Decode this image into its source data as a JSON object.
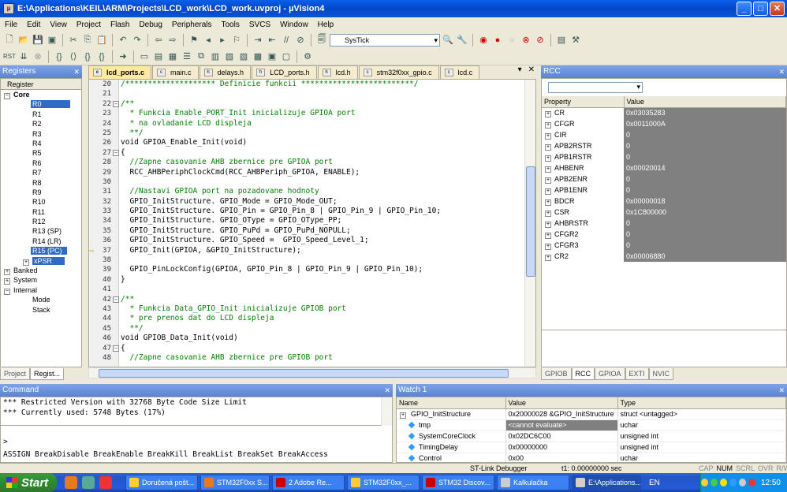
{
  "window": {
    "title": "E:\\Applications\\KEIL\\ARM\\Projects\\LCD_work\\LCD_work.uvproj - µVision4",
    "min": "_",
    "max": "□",
    "close": "✕"
  },
  "menu": [
    "File",
    "Edit",
    "View",
    "Project",
    "Flash",
    "Debug",
    "Peripherals",
    "Tools",
    "SVCS",
    "Window",
    "Help"
  ],
  "toolbar": {
    "combo_value": "SysTick"
  },
  "registers": {
    "title": "Registers",
    "col_header": "Register",
    "core_label": "Core",
    "items": [
      "R0",
      "R1",
      "R2",
      "R3",
      "R4",
      "R5",
      "R6",
      "R7",
      "R8",
      "R9",
      "R10",
      "R11",
      "R12",
      "R13 (SP)",
      "R14 (LR)",
      "R15 (PC)",
      "xPSR"
    ],
    "groups": [
      "Banked",
      "System",
      "Internal"
    ],
    "internal_children": [
      "Mode",
      "Stack"
    ],
    "tabs": [
      "Project",
      "Regist..."
    ]
  },
  "editor": {
    "tabs": [
      "lcd_ports.c",
      "main.c",
      "delays.h",
      "LCD_ports.h",
      "lcd.h",
      "stm32f0xx_gpio.c",
      "lcd.c"
    ],
    "lines": [
      {
        "n": "20",
        "t": "/******************** Definicie funkcii *************************/",
        "c": "cm",
        "f": ""
      },
      {
        "n": "21",
        "t": "",
        "c": "",
        "f": ""
      },
      {
        "n": "22",
        "t": "/**",
        "c": "cm",
        "f": "−"
      },
      {
        "n": "23",
        "t": "  * Funkcia Enable_PORT_Init inicializuje GPIOA port",
        "c": "cm",
        "f": ""
      },
      {
        "n": "24",
        "t": "  * na ovladanie LCD displeja",
        "c": "cm",
        "f": ""
      },
      {
        "n": "25",
        "t": "  **/",
        "c": "cm",
        "f": ""
      },
      {
        "n": "26",
        "t": "void GPIOA_Enable_Init(void)",
        "c": "",
        "f": ""
      },
      {
        "n": "27",
        "t": "{",
        "c": "",
        "f": "−"
      },
      {
        "n": "28",
        "t": "  //Zapne casovanie AHB zbernice pre GPIOA port",
        "c": "cm",
        "f": ""
      },
      {
        "n": "29",
        "t": "  RCC_AHBPeriphClockCmd(RCC_AHBPeriph_GPIOA, ENABLE);",
        "c": "",
        "f": ""
      },
      {
        "n": "30",
        "t": "",
        "c": "",
        "f": ""
      },
      {
        "n": "31",
        "t": "  //Nastavi GPIOA port na pozadovane hodnoty",
        "c": "cm",
        "f": ""
      },
      {
        "n": "32",
        "t": "  GPIO_InitStructure. GPIO_Mode = GPIO_Mode_OUT;",
        "c": "",
        "f": ""
      },
      {
        "n": "33",
        "t": "  GPIO_InitStructure. GPIO_Pin = GPIO_Pin_8 | GPIO_Pin_9 | GPIO_Pin_10;",
        "c": "",
        "f": ""
      },
      {
        "n": "34",
        "t": "  GPIO_InitStructure. GPIO_OType = GPIO_OType_PP;",
        "c": "",
        "f": ""
      },
      {
        "n": "35",
        "t": "  GPIO_InitStructure. GPIO_PuPd = GPIO_PuPd_NOPULL;",
        "c": "",
        "f": ""
      },
      {
        "n": "36",
        "t": "  GPIO_InitStructure. GPIO_Speed =  GPIO_Speed_Level_1;",
        "c": "",
        "f": ""
      },
      {
        "n": "37",
        "t": "  GPIO_Init(GPIOA, &GPIO_InitStructure);",
        "c": "",
        "f": ""
      },
      {
        "n": "38",
        "t": "",
        "c": "",
        "f": ""
      },
      {
        "n": "39",
        "t": "  GPIO_PinLockConfig(GPIOA, GPIO_Pin_8 | GPIO_Pin_9 | GPIO_Pin_10);",
        "c": "",
        "f": ""
      },
      {
        "n": "40",
        "t": "}",
        "c": "",
        "f": ""
      },
      {
        "n": "41",
        "t": "",
        "c": "",
        "f": ""
      },
      {
        "n": "42",
        "t": "/**",
        "c": "cm",
        "f": "−"
      },
      {
        "n": "43",
        "t": "  * Funkcia Data_GPIO_Init inicializuje GPIOB port",
        "c": "cm",
        "f": ""
      },
      {
        "n": "44",
        "t": "  * pre prenos dat do LCD displeja",
        "c": "cm",
        "f": ""
      },
      {
        "n": "45",
        "t": "  **/",
        "c": "cm",
        "f": ""
      },
      {
        "n": "46",
        "t": "void GPIOB_Data_Init(void)",
        "c": "",
        "f": ""
      },
      {
        "n": "47",
        "t": "{",
        "c": "",
        "f": "−"
      },
      {
        "n": "48",
        "t": "  //Zapne casovanie AHB zbernice pre GPIOB port",
        "c": "cm",
        "f": ""
      }
    ],
    "current_line": "37"
  },
  "rcc": {
    "title": "RCC",
    "headers": [
      "Property",
      "Value"
    ],
    "rows": [
      [
        "CR",
        "0x03035283"
      ],
      [
        "CFGR",
        "0x0011000A"
      ],
      [
        "CIR",
        "0"
      ],
      [
        "APB2RSTR",
        "0"
      ],
      [
        "APB1RSTR",
        "0"
      ],
      [
        "AHBENR",
        "0x00020014"
      ],
      [
        "APB2ENR",
        "0"
      ],
      [
        "APB1ENR",
        "0"
      ],
      [
        "BDCR",
        "0x00000018"
      ],
      [
        "CSR",
        "0x1C800000"
      ],
      [
        "AHBRSTR",
        "0"
      ],
      [
        "CFGR2",
        "0"
      ],
      [
        "CFGR3",
        "0"
      ],
      [
        "CR2",
        "0x00006880"
      ]
    ],
    "tabs": [
      "GPIOB",
      "RCC",
      "GPIOA",
      "EXTI",
      "NVIC"
    ]
  },
  "command": {
    "title": "Command",
    "lines": [
      "*** Restricted Version with 32768 Byte Code Size Limit",
      "*** Currently used: 5748 Bytes (17%)"
    ],
    "prompt": ">",
    "hint": "ASSIGN BreakDisable BreakEnable BreakKill BreakList BreakSet BreakAccess"
  },
  "watch": {
    "title": "Watch 1",
    "headers": [
      "Name",
      "Value",
      "Type"
    ],
    "rows": [
      [
        "GPIO_InitStructure",
        "0x20000028 &GPIO_InitStructure",
        "struct <untagged>"
      ],
      [
        "tmp",
        "<cannot evaluate>",
        "uchar"
      ],
      [
        "SystemCoreClock",
        "0x02DC6C00",
        "unsigned int"
      ],
      [
        "TimingDelay",
        "0x00000000",
        "unsigned int"
      ],
      [
        "Control",
        "0x00",
        "uchar"
      ]
    ]
  },
  "status": {
    "debugger": "ST-Link Debugger",
    "time": "t1: 0.00000000 sec",
    "indicators": [
      "CAP",
      "NUM",
      "SCRL",
      "OVR",
      "R/W"
    ]
  },
  "taskbar": {
    "start": "Start",
    "tasks": [
      "Doručená pošt...",
      "STM32F0xx S...",
      "2 Adobe Re...",
      "STM32F0xx_...",
      "STM32 Discov...",
      "Kalkulačka",
      "E:\\Applications..."
    ],
    "lang": "EN",
    "clock": "12:50"
  }
}
